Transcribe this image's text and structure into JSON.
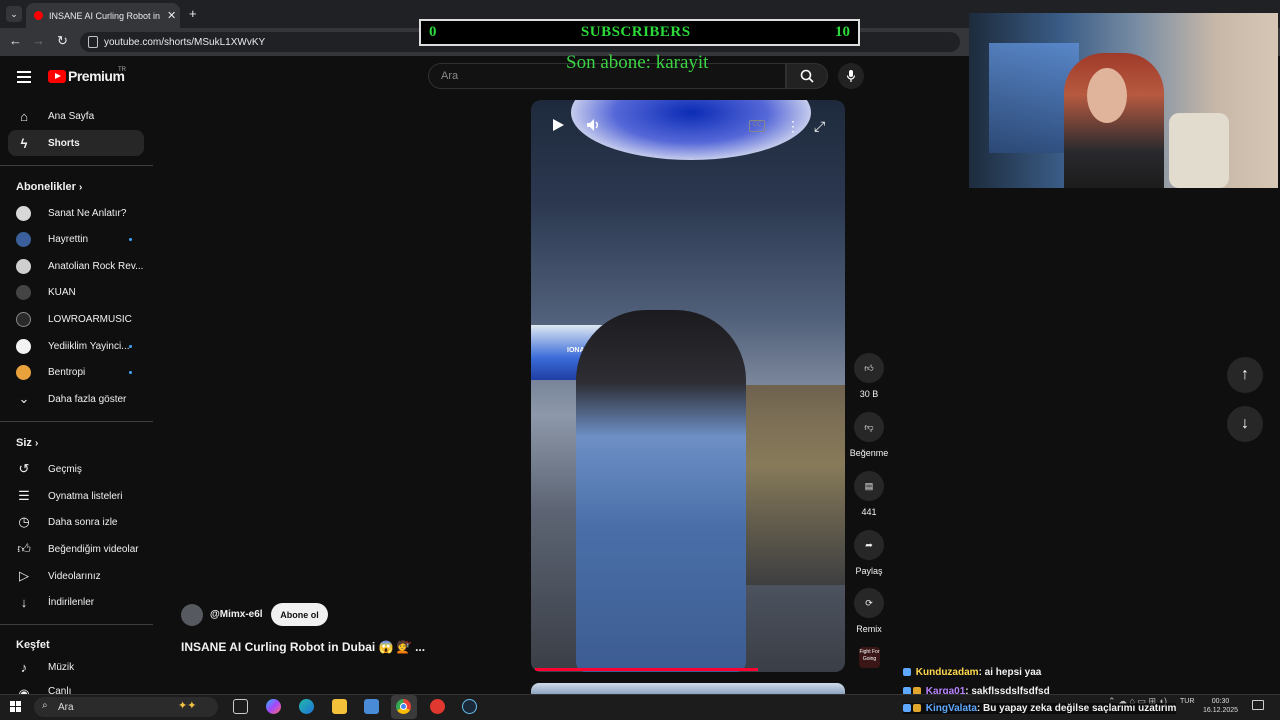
{
  "browser": {
    "tab_title": "INSANE AI Curling Robot in Dubai",
    "url": "youtube.com/shorts/MSukL1XWvKY"
  },
  "header": {
    "logo": "Premium",
    "logo_badge": "TR",
    "search_placeholder": "Ara"
  },
  "overlay": {
    "left_count": "0",
    "label": "SUBSCRIBERS",
    "right_count": "10",
    "last_sub": "Son abone: karayit"
  },
  "sidebar": {
    "home": "Ana Sayfa",
    "shorts": "Shorts",
    "subs_header": "Abonelikler",
    "subscriptions": [
      {
        "name": "Sanat Ne Anlatır?",
        "color": "#d8d8d8"
      },
      {
        "name": "Hayrettin",
        "color": "#3a5f9a"
      },
      {
        "name": "Anatolian Rock Rev...",
        "color": "#cfcfcf"
      },
      {
        "name": "KUAN",
        "color": "#444444"
      },
      {
        "name": "LOWROARMUSIC",
        "color": "#2a2a2a"
      },
      {
        "name": "Yediiklim Yayinci...",
        "color": "#f2f2f2"
      },
      {
        "name": "Bentropi",
        "color": "#e9a23b"
      }
    ],
    "show_more": "Daha fazla göster",
    "you_header": "Siz",
    "you_items": [
      "Geçmiş",
      "Oynatma listeleri",
      "Daha sonra izle",
      "Beğendiğim videolar",
      "Videolarınız",
      "İndirilenler"
    ],
    "explore_header": "Keşfet",
    "explore_items": [
      "Müzik",
      "Canlı"
    ]
  },
  "video": {
    "channel": "@Mimx-e6l",
    "subscribe": "Abone ol",
    "title": "INSANE AI Curling Robot in Dubai 😱 💇 ...",
    "booth_label": "IONA LABS",
    "progress": 0.73
  },
  "actions": {
    "likes": "30 B",
    "dislike": "Beğenme",
    "comments": "441",
    "share": "Paylaş",
    "remix": "Remix"
  },
  "chat": [
    {
      "user": "Kunduzadam",
      "msg": ": ai hepsi yaa"
    },
    {
      "user": "Karga01",
      "msg": ": şakflşsdşlfsdfsd"
    },
    {
      "user": "KingValata",
      "msg": ": Bu yapay zeka değilse saçlarımı uzatırım"
    }
  ],
  "taskbar": {
    "search": "Ara",
    "lang": "TUR",
    "time": "00:30",
    "date": "16.12.2025"
  }
}
